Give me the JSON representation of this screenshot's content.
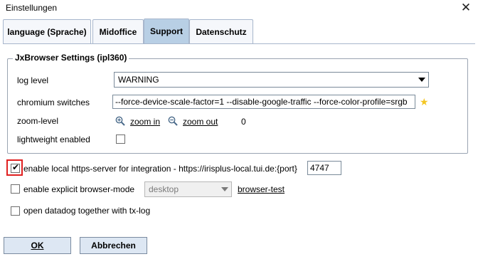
{
  "window": {
    "title": "Einstellungen",
    "close_glyph": "✕"
  },
  "tabs": [
    {
      "label": "language (Sprache)",
      "active": false
    },
    {
      "label": "Midoffice",
      "active": false
    },
    {
      "label": "Support",
      "active": true
    },
    {
      "label": "Datenschutz",
      "active": false
    }
  ],
  "jx": {
    "legend": "JxBrowser Settings (ipl360)",
    "log_level_label": "log level",
    "log_level_value": "WARNING",
    "chromium_label": "chromium switches",
    "chromium_value": "--force-device-scale-factor=1 --disable-google-traffic --force-color-profile=srgb",
    "zoom_label": "zoom-level",
    "zoom_in": "zoom in",
    "zoom_out": "zoom out",
    "zoom_value": "0",
    "lightweight_label": "lightweight enabled",
    "lightweight_checked": false
  },
  "https_server": {
    "label": "enable local https-server for integration - https://irisplus-local.tui.de:{port}",
    "port": "4747",
    "checked": true
  },
  "browser_mode": {
    "label": "enable explicit browser-mode",
    "mode_value": "desktop",
    "test_link": "browser-test",
    "checked": false
  },
  "datadog": {
    "label": "open datadog together with tx-log",
    "checked": false
  },
  "buttons": {
    "ok": "OK",
    "cancel": "Abbrechen"
  },
  "colors": {
    "active_tab": "#b8cfe5",
    "highlight_border": "#e02020",
    "star": "#f3c623"
  }
}
